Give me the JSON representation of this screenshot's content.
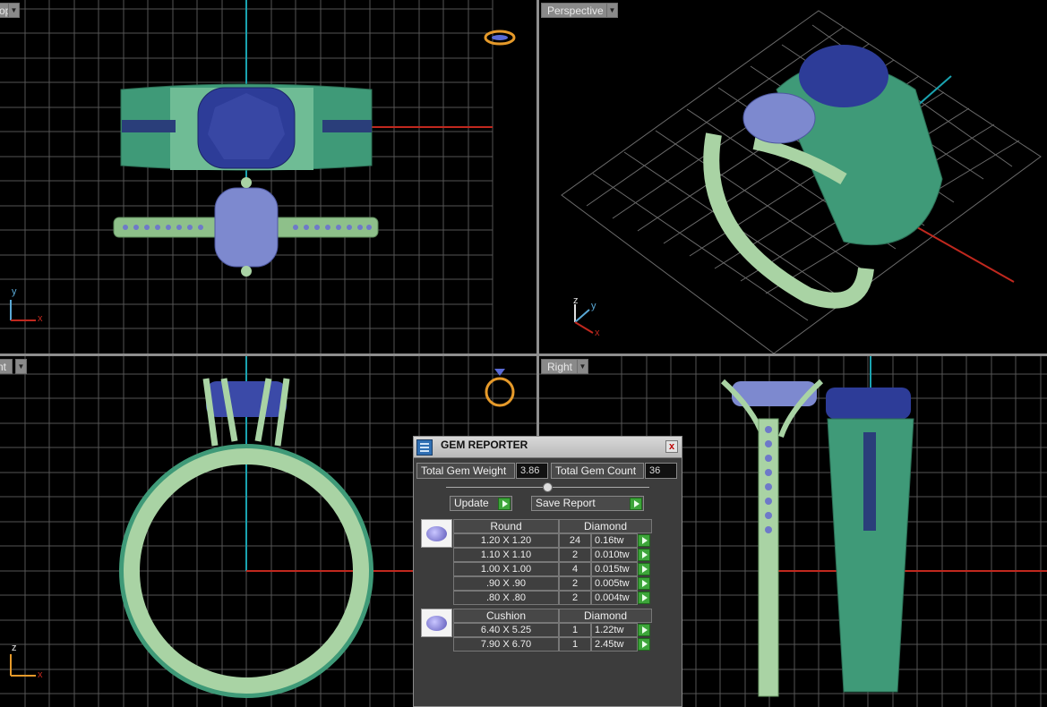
{
  "viewports": {
    "top": {
      "label": "Top",
      "axes": [
        "y",
        "x"
      ]
    },
    "perspective": {
      "label": "Perspective",
      "axes": [
        "z",
        "y",
        "x"
      ]
    },
    "front": {
      "label": "Front",
      "axes": [
        "z",
        "x"
      ]
    },
    "right": {
      "label": "Right"
    }
  },
  "colors": {
    "grid": "#5a5a5a",
    "axis_red": "#c0281e",
    "axis_cyan": "#1aa3b0",
    "metal_light": "#a9d3a4",
    "metal_dark": "#3f9a78",
    "gem": "#3b4aa8",
    "gem_light": "#7d89cf"
  },
  "gem_reporter": {
    "title": "GEM REPORTER",
    "close_glyph": "x",
    "total_weight_label": "Total Gem Weight",
    "total_weight_value": "3.86",
    "total_count_label": "Total Gem Count",
    "total_count_value": "36",
    "update_label": "Update",
    "save_report_label": "Save Report",
    "groups": [
      {
        "shape": "Round",
        "material": "Diamond",
        "rows": [
          {
            "size": "1.20 X 1.20",
            "count": "24",
            "weight": "0.16tw"
          },
          {
            "size": "1.10 X 1.10",
            "count": "2",
            "weight": "0.010tw"
          },
          {
            "size": "1.00 X 1.00",
            "count": "4",
            "weight": "0.015tw"
          },
          {
            "size": ".90 X .90",
            "count": "2",
            "weight": "0.005tw"
          },
          {
            "size": ".80 X .80",
            "count": "2",
            "weight": "0.004tw"
          }
        ]
      },
      {
        "shape": "Cushion",
        "material": "Diamond",
        "rows": [
          {
            "size": "6.40 X 5.25",
            "count": "1",
            "weight": "1.22tw"
          },
          {
            "size": "7.90 X 6.70",
            "count": "1",
            "weight": "2.45tw"
          }
        ]
      }
    ]
  }
}
